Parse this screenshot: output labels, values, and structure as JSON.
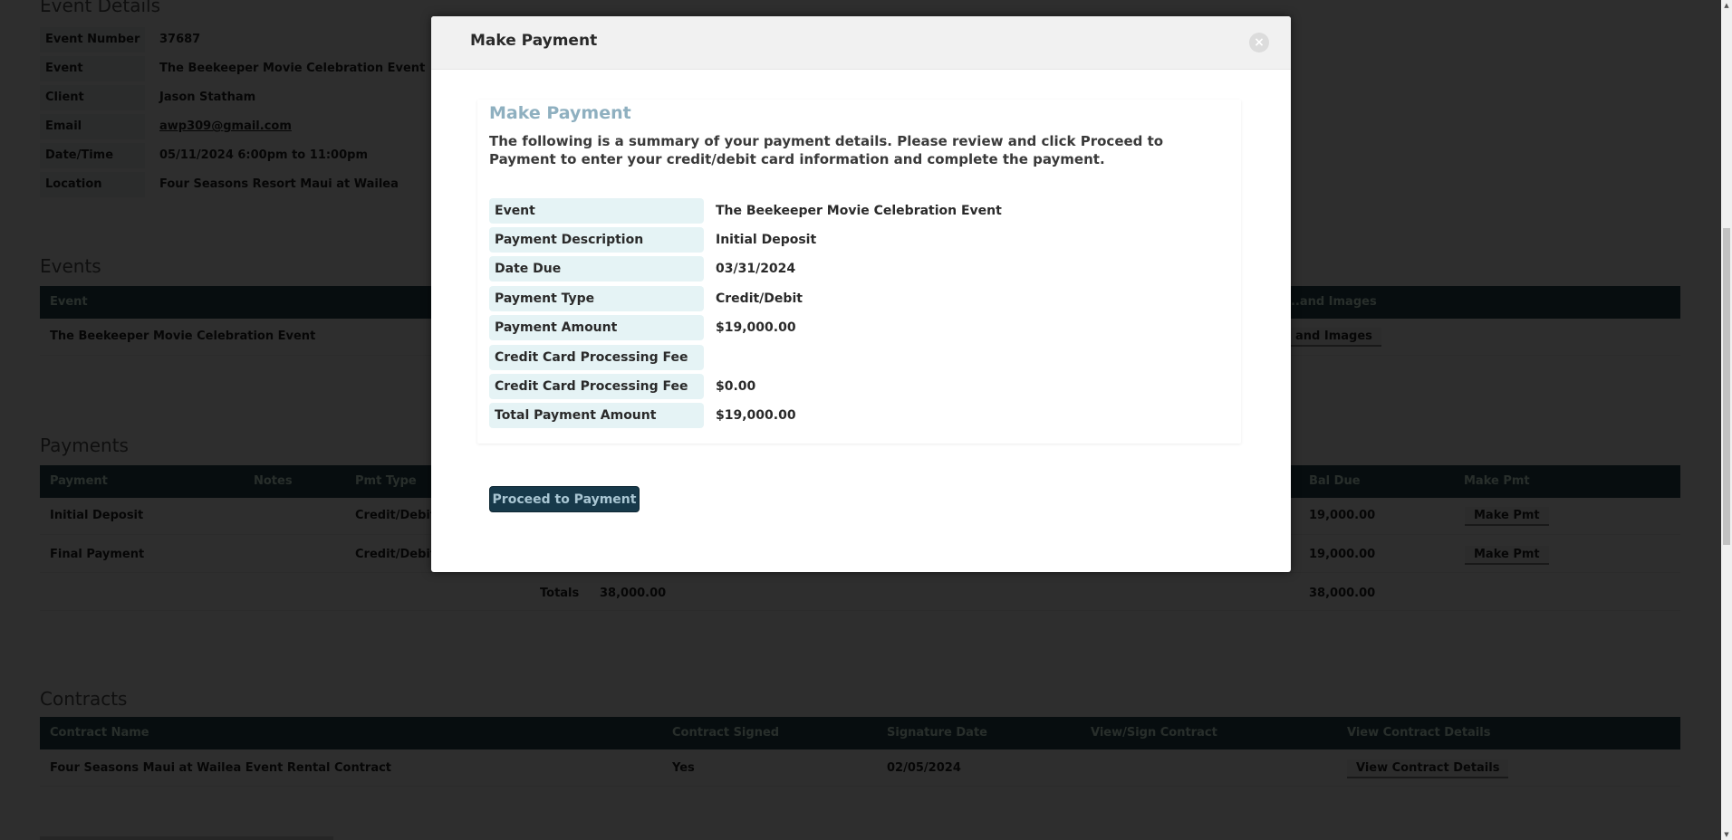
{
  "event_details": {
    "title": "Event Details",
    "rows": [
      {
        "label": "Event Number",
        "value": "37687"
      },
      {
        "label": "Event",
        "value": "The Beekeeper Movie Celebration Event"
      },
      {
        "label": "Client",
        "value": "Jason Statham"
      },
      {
        "label": "Email",
        "value": "awp309@gmail.com"
      },
      {
        "label": "Date/Time",
        "value": "05/11/2024 6:00pm to 11:00pm"
      },
      {
        "label": "Location",
        "value": "Four Seasons Resort Maui at Wailea"
      }
    ]
  },
  "events": {
    "title": "Events",
    "headers": [
      "Event",
      "...and Images"
    ],
    "rows": [
      {
        "event": "The Beekeeper Movie Celebration Event",
        "link": "and Images"
      }
    ]
  },
  "payments": {
    "title": "Payments",
    "headers": {
      "payment": "Payment",
      "notes": "Notes",
      "pmt_type": "Pmt Type",
      "bal_due": "Bal Due",
      "make_pmt": "Make Pmt"
    },
    "rows": [
      {
        "payment": "Initial Deposit",
        "pmt_type": "Credit/Debit",
        "bal_due": "19,000.00",
        "button": "Make Pmt"
      },
      {
        "payment": "Final Payment",
        "pmt_type": "Credit/Debit",
        "bal_due": "19,000.00",
        "button": "Make Pmt"
      }
    ],
    "totals_label": "Totals",
    "totals_amount": "38,000.00",
    "totals_bal_due": "38,000.00"
  },
  "contracts": {
    "title": "Contracts",
    "headers": {
      "name": "Contract Name",
      "signed": "Contract Signed",
      "sig_date": "Signature Date",
      "view_sign": "View/Sign Contract",
      "view_details": "View Contract Details"
    },
    "rows": [
      {
        "name": "Four Seasons Maui at Wailea Event Rental Contract",
        "signed": "Yes",
        "sig_date": "02/05/2024",
        "button": "View Contract Details"
      }
    ]
  },
  "modal": {
    "title": "Make Payment",
    "close_icon": "close-icon",
    "heading": "Make Payment",
    "description": "The following is a summary of your payment details. Please review and click Proceed to Payment to enter your credit/debit card information and complete the payment.",
    "details": [
      {
        "label": "Event",
        "value": "The Beekeeper Movie Celebration Event"
      },
      {
        "label": "Payment Description",
        "value": "Initial Deposit"
      },
      {
        "label": "Date Due",
        "value": "03/31/2024"
      },
      {
        "label": "Payment Type",
        "value": "Credit/Debit"
      },
      {
        "label": "Payment Amount",
        "value": "$19,000.00"
      },
      {
        "label": "Credit Card Processing Fee %",
        "value": ""
      },
      {
        "label": "Credit Card Processing Fee",
        "value": "$0.00"
      },
      {
        "label": "Total Payment Amount",
        "value": "$19,000.00"
      }
    ],
    "proceed_label": "Proceed to Payment"
  },
  "colors": {
    "primary_button": "#17394a",
    "heading_accent": "#8fb0c0",
    "label_bg": "#e5f3f5",
    "table_header": "#2b4a52"
  }
}
